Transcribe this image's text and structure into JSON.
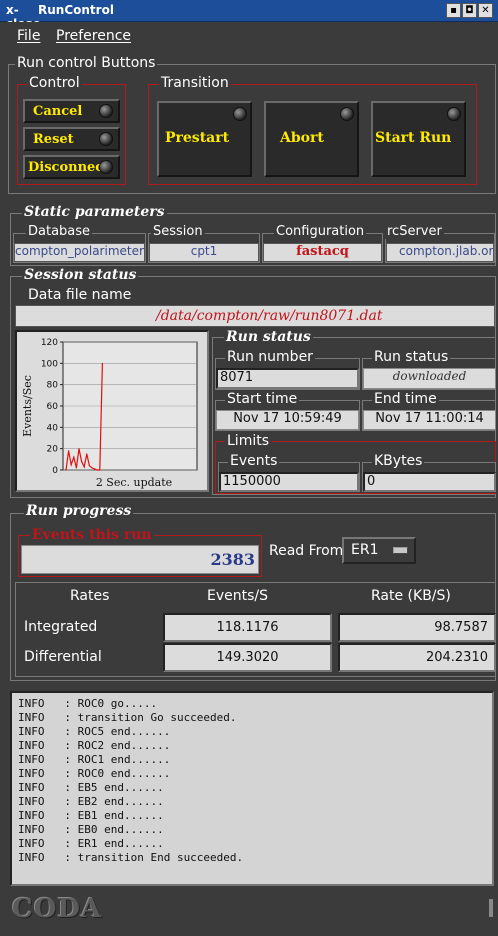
{
  "window": {
    "title": "RunControl",
    "icon": "x-close-icon",
    "controls": [
      "▪",
      "◘",
      "✕"
    ]
  },
  "menu": {
    "file": "File",
    "preference": "Preference"
  },
  "run_control": {
    "title": "Run control Buttons",
    "control": {
      "title": "Control",
      "cancel": "Cancel",
      "reset": "Reset",
      "disconnect": "Disconnect"
    },
    "transition": {
      "title": "Transition",
      "prestart": "Prestart",
      "abort": "Abort",
      "start_run": "Start Run"
    }
  },
  "static_parameters": {
    "title": "Static parameters",
    "database_label": "Database",
    "database": "compton_polarimeter",
    "session_label": "Session",
    "session": "cpt1",
    "configuration_label": "Configuration",
    "configuration": "fastacq",
    "rcserver_label": "rcServer",
    "rcserver": "compton.jlab.org"
  },
  "session_status": {
    "title": "Session status",
    "data_file_label": "Data file name",
    "data_file": "/data/compton/raw/run8071.dat"
  },
  "chart_data": {
    "type": "line",
    "ylabel": "Events/Sec",
    "xlabel": "2 Sec. update",
    "ylim": [
      0,
      120
    ],
    "yticks": [
      "120",
      "100",
      "80",
      "60",
      "40",
      "20",
      "0"
    ],
    "values": [
      0,
      18,
      5,
      12,
      2,
      20,
      8,
      3,
      15,
      4,
      2,
      1,
      0,
      0,
      100
    ]
  },
  "run_status": {
    "title": "Run status",
    "run_number_label": "Run number",
    "run_number": "8071",
    "run_status_label": "Run status",
    "run_status": "downloaded",
    "start_time_label": "Start time",
    "start_time": "Nov 17 10:59:49",
    "end_time_label": "End time",
    "end_time": "Nov 17 11:00:14",
    "limits_label": "Limits",
    "events_label": "Events",
    "events": "1150000",
    "kbytes_label": "KBytes",
    "kbytes": "0"
  },
  "run_progress": {
    "title": "Run progress",
    "events_this_run_label": "Events this run",
    "events_this_run": "2383",
    "read_from_label": "Read From:",
    "read_from": "ER1"
  },
  "rates": {
    "header": "Rates",
    "events_header": "Events/S",
    "rate_header": "Rate (KB/S)",
    "integrated_label": "Integrated",
    "integrated_events": "118.1176",
    "integrated_rate": "98.7587",
    "differential_label": "Differential",
    "differential_events": "149.3020",
    "differential_rate": "204.2310"
  },
  "log": [
    "INFO   : ROC0 go.....",
    "INFO   : transition Go succeeded.",
    "INFO   : ROC5 end......",
    "INFO   : ROC2 end......",
    "INFO   : ROC1 end......",
    "INFO   : ROC0 end......",
    "INFO   : EB5 end......",
    "INFO   : EB2 end......",
    "INFO   : EB1 end......",
    "INFO   : EB0 end......",
    "INFO   : ER1 end......",
    "INFO   : transition End succeeded."
  ],
  "footer": {
    "logo": "CODA"
  }
}
